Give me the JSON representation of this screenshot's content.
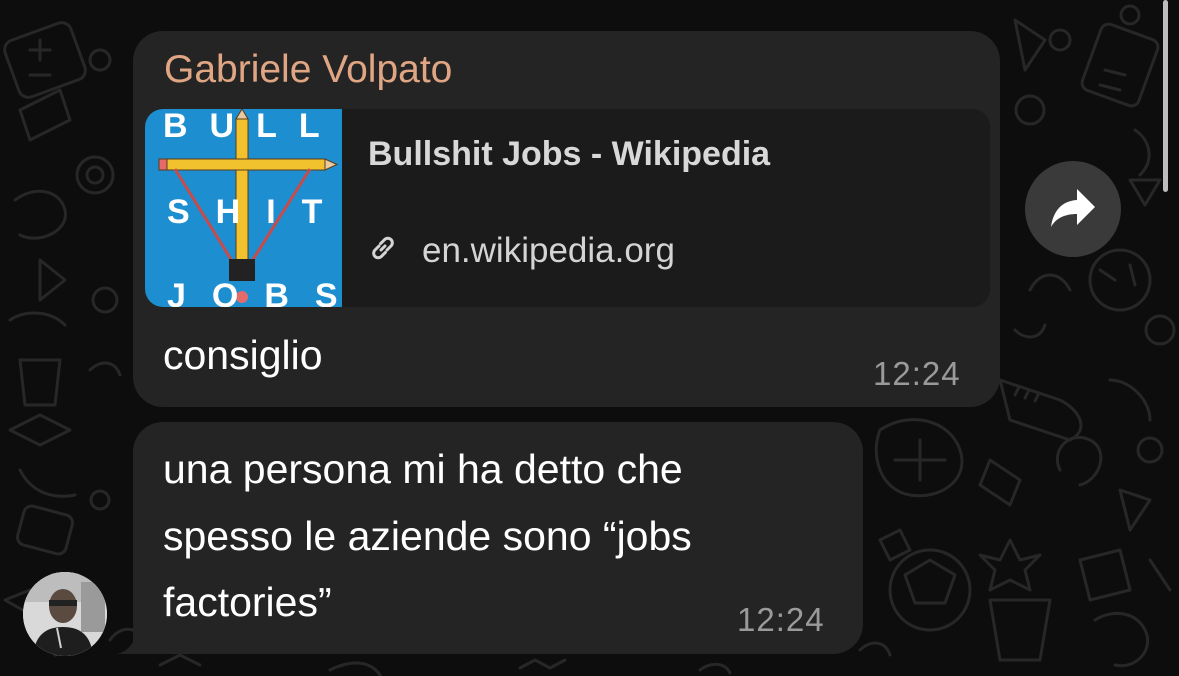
{
  "message_1": {
    "sender": "Gabriele Volpato",
    "link_preview": {
      "title": "Bullshit Jobs - Wikipedia",
      "domain": "en.wikipedia.org",
      "thumbnail_letters": {
        "row1": "BULL",
        "row2": "SHIT",
        "row3": "JOBS"
      }
    },
    "text": "consiglio",
    "time": "12:24"
  },
  "message_2": {
    "lines": [
      "una persona mi ha detto che",
      "spesso le aziende sono “jobs",
      "factories”"
    ],
    "time": "12:24"
  },
  "icons": {
    "forward": "forward-arrow-icon",
    "link": "link-icon",
    "avatar": "avatar-photo"
  },
  "colors": {
    "background": "#0d0d0d",
    "bubble": "#242424",
    "sender_name": "#e0a684",
    "timestamp": "#9a9a9a",
    "thumbnail_bg": "#1d8fd0"
  }
}
